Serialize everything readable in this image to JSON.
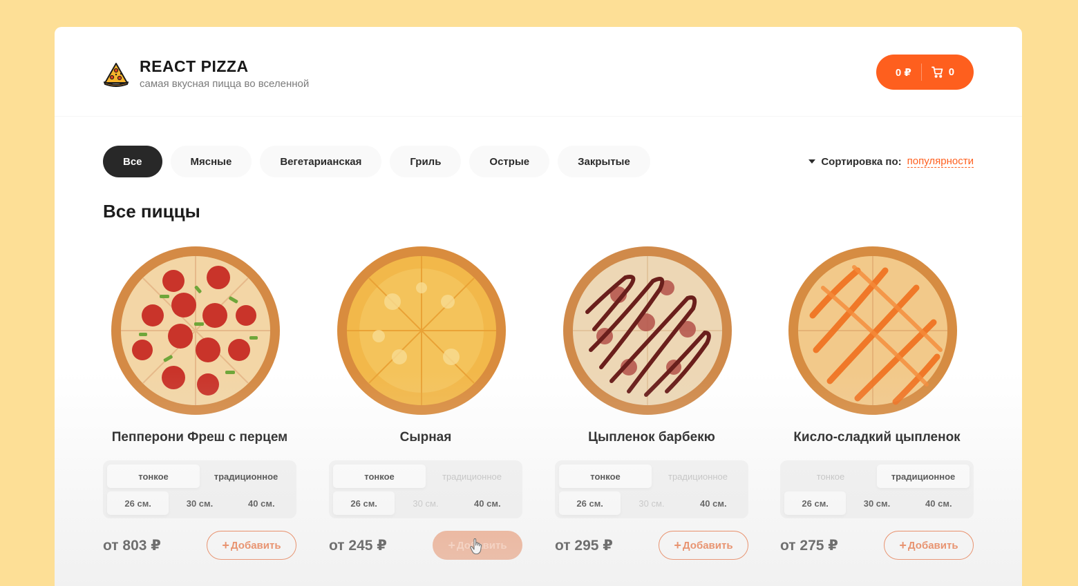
{
  "header": {
    "title": "REACT PIZZA",
    "subtitle": "самая вкусная пицца во вселенной",
    "cart": {
      "total": "0 ₽",
      "count": "0"
    }
  },
  "categories": [
    "Все",
    "Мясные",
    "Вегетарианская",
    "Гриль",
    "Острые",
    "Закрытые"
  ],
  "active_category": "Все",
  "sort": {
    "label": "Сортировка по:",
    "value": "популярности"
  },
  "content_title": "Все пиццы",
  "pizzas": [
    {
      "title": "Пепперони Фреш с перцем",
      "types": [
        "тонкое",
        "традиционное"
      ],
      "sizes": [
        "26 см.",
        "30 см.",
        "40 см."
      ],
      "price": "от 803 ₽",
      "add_label": "Добавить",
      "add_plus": "+"
    },
    {
      "title": "Сырная",
      "types": [
        "тонкое",
        "традиционное"
      ],
      "sizes": [
        "26 см.",
        "30 см.",
        "40 см."
      ],
      "price": "от 245 ₽",
      "add_label": "Добавить",
      "add_plus": "+"
    },
    {
      "title": "Цыпленок барбекю",
      "types": [
        "тонкое",
        "традиционное"
      ],
      "sizes": [
        "26 см.",
        "30 см.",
        "40 см."
      ],
      "price": "от 295 ₽",
      "add_label": "Добавить",
      "add_plus": "+"
    },
    {
      "title": "Кисло-сладкий цыпленок",
      "types": [
        "тонкое",
        "традиционное"
      ],
      "sizes": [
        "26 см.",
        "30 см.",
        "40 см."
      ],
      "price": "от 275 ₽",
      "add_label": "Добавить",
      "add_plus": "+"
    }
  ],
  "colors": {
    "accent": "#fe5f1e",
    "background": "#fddf96",
    "dark": "#282828"
  }
}
